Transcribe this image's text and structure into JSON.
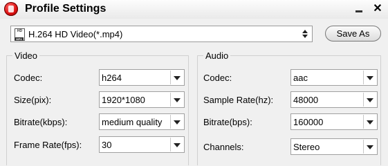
{
  "window": {
    "title": "Profile Settings"
  },
  "format": {
    "selected": "H.264 HD Video(*.mp4)",
    "icon_text": "HD",
    "icon_tag": "MP4"
  },
  "toolbar": {
    "save_as_label": "Save As"
  },
  "video": {
    "legend": "Video",
    "codec": {
      "label": "Codec:",
      "value": "h264"
    },
    "size": {
      "label": "Size(pix):",
      "value": "1920*1080"
    },
    "bitrate": {
      "label": "Bitrate(kbps):",
      "value": "medium quality"
    },
    "frame_rate": {
      "label": "Frame Rate(fps):",
      "value": "30"
    }
  },
  "audio": {
    "legend": "Audio",
    "codec": {
      "label": "Codec:",
      "value": "aac"
    },
    "sample_rate": {
      "label": "Sample Rate(hz):",
      "value": "48000"
    },
    "bitrate": {
      "label": "Bitrate(bps):",
      "value": "160000"
    },
    "channels": {
      "label": "Channels:",
      "value": "Stereo"
    }
  },
  "icons": [
    "app-logo-icon",
    "minimize-icon",
    "close-icon",
    "mp4-file-icon",
    "spinner-arrows-icon",
    "dropdown-arrow-icon"
  ]
}
